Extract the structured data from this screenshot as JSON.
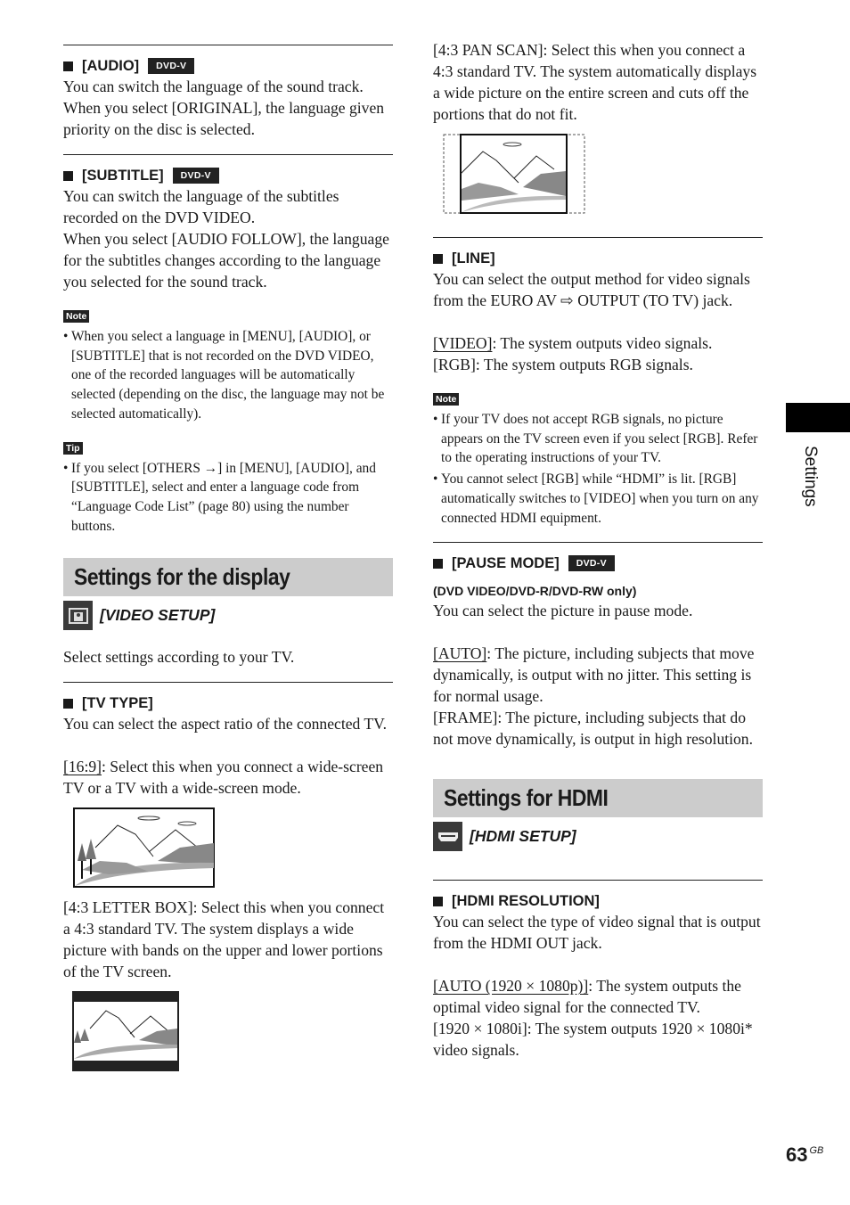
{
  "audio": {
    "heading": "[AUDIO]",
    "badge": "DVD-V",
    "text": "You can switch the language of the sound track. When you select [ORIGINAL], the language given priority on the disc is selected."
  },
  "subtitle": {
    "heading": "[SUBTITLE]",
    "badge": "DVD-V",
    "text1": "You can switch the language of the subtitles recorded on the DVD VIDEO.",
    "text2": "When you select [AUDIO FOLLOW], the language for the subtitles changes according to the language you selected for the sound track."
  },
  "note1": {
    "label": "Note",
    "bullets": [
      "When you select a language in [MENU], [AUDIO], or [SUBTITLE] that is not recorded on the DVD VIDEO, one of the recorded languages will be automatically selected (depending on the disc, the language may not be selected automatically)."
    ]
  },
  "tip": {
    "label": "Tip",
    "bullets": [
      "If you select [OTHERS →] in [MENU], [AUDIO], and [SUBTITLE], select and enter a language code from “Language Code List” (page 80) using the number buttons."
    ]
  },
  "display_section": {
    "title": "Settings for the display",
    "setup_label": "[VIDEO SETUP]",
    "setup_icon": "video-setup-icon",
    "intro": "Select settings according to your TV."
  },
  "tv_type": {
    "heading": "[TV TYPE]",
    "text": "You can select the aspect ratio of the connected TV.",
    "opt169_label": "[16:9]",
    "opt169_text": ": Select this when you connect a wide-screen TV or a TV with a wide-screen mode.",
    "letterbox_text": "[4:3 LETTER BOX]: Select this when you connect a 4:3 standard TV. The system displays a wide picture with bands on the upper and lower portions of the TV screen.",
    "panscan_text": "[4:3 PAN SCAN]: Select this when you connect a 4:3 standard TV. The system automatically displays a wide picture on the entire screen and cuts off the portions that do not fit."
  },
  "line": {
    "heading": "[LINE]",
    "text_before": "You can select the output method for video signals from the EURO AV ",
    "text_after": " OUTPUT (TO TV) jack.",
    "video_label": "[VIDEO]",
    "video_text": ": The system outputs video signals.",
    "rgb_text": "[RGB]: The system outputs RGB signals."
  },
  "note2": {
    "label": "Note",
    "bullets": [
      "If your TV does not accept RGB signals, no picture appears on the TV screen even if you select [RGB]. Refer to the operating instructions of your TV.",
      "You cannot select [RGB] while “HDMI” is lit. [RGB] automatically switches to [VIDEO] when you turn on any connected HDMI equipment."
    ]
  },
  "pause_mode": {
    "heading": "[PAUSE MODE]",
    "badge": "DVD-V",
    "subheading": "(DVD VIDEO/DVD-R/DVD-RW only)",
    "text": "You can select the picture in pause mode.",
    "auto_label": "[AUTO]",
    "auto_text": ": The picture, including subjects that move dynamically, is output with no jitter. This setting is for normal usage.",
    "frame_text": "[FRAME]: The picture, including subjects that do not move dynamically, is output in high resolution."
  },
  "hdmi_section": {
    "title": "Settings for HDMI",
    "setup_label": "[HDMI SETUP]",
    "setup_icon": "hdmi-setup-icon"
  },
  "hdmi_resolution": {
    "heading": "[HDMI RESOLUTION]",
    "text": "You can select the type of video signal that is output from the HDMI OUT jack.",
    "auto_label": "[AUTO (1920 × 1080p)]",
    "auto_text": ": The system outputs the optimal video signal for the connected TV.",
    "i1080_text": "[1920 × 1080i]: The system outputs 1920 × 1080i* video signals."
  },
  "side_tab": {
    "label": "Settings"
  },
  "footer": {
    "page_number": "63",
    "region": "GB"
  }
}
